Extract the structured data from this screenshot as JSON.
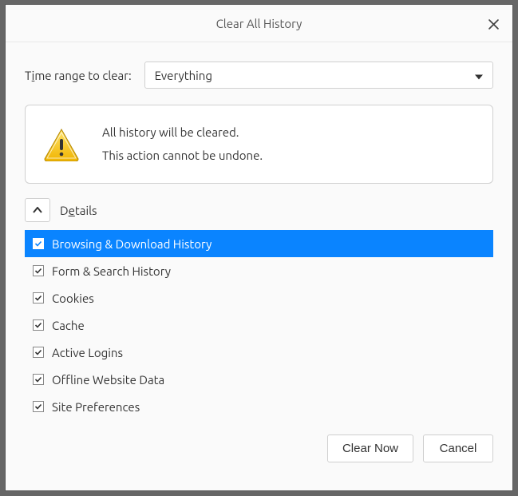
{
  "dialog": {
    "title": "Clear All History"
  },
  "range": {
    "label_pre": "T",
    "label_mn": "i",
    "label_post": "me range to clear:",
    "selected": "Everything"
  },
  "warning": {
    "line1": "All history will be cleared.",
    "line2": "This action cannot be undone."
  },
  "details": {
    "label_pre": "D",
    "label_mn": "e",
    "label_post": "tails"
  },
  "items": [
    {
      "label": "Browsing & Download History",
      "checked": true,
      "selected": true
    },
    {
      "label": "Form & Search History",
      "checked": true,
      "selected": false
    },
    {
      "label": "Cookies",
      "checked": true,
      "selected": false
    },
    {
      "label": "Cache",
      "checked": true,
      "selected": false
    },
    {
      "label": "Active Logins",
      "checked": true,
      "selected": false
    },
    {
      "label": "Offline Website Data",
      "checked": true,
      "selected": false
    },
    {
      "label": "Site Preferences",
      "checked": true,
      "selected": false
    }
  ],
  "buttons": {
    "clear": "Clear Now",
    "cancel": "Cancel"
  }
}
